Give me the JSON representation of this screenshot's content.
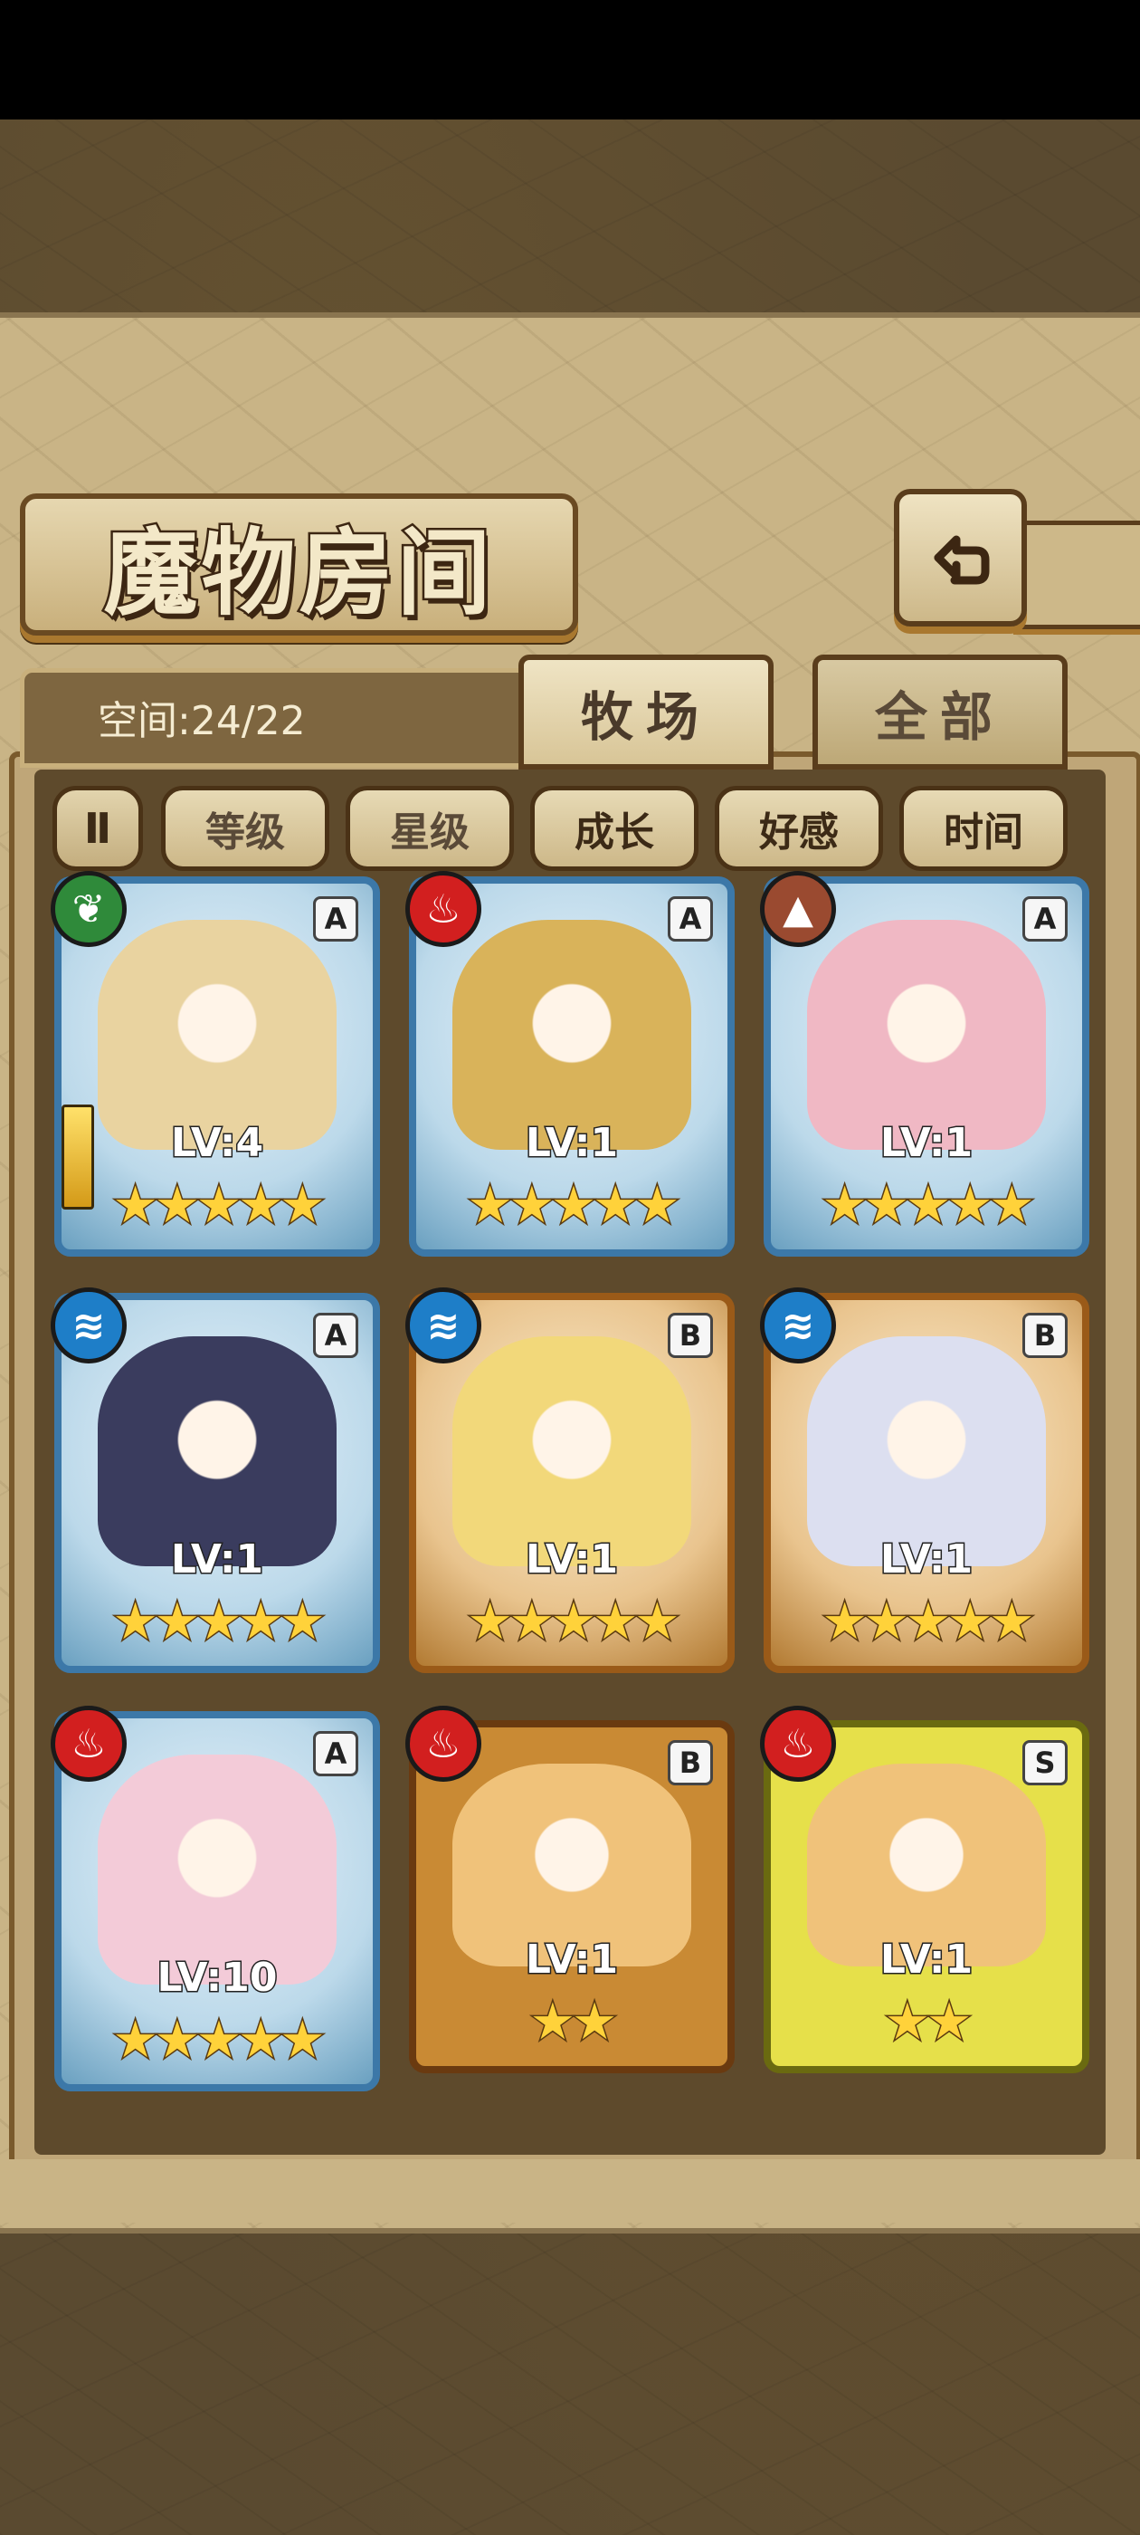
{
  "header": {
    "title": "魔物房间"
  },
  "capacity": {
    "label": "空间:24/22"
  },
  "tabs": [
    {
      "label": "牧场",
      "active": true
    },
    {
      "label": "全部",
      "active": false
    }
  ],
  "sort": {
    "toggle_icon": "filter-toggle-icon",
    "buttons": [
      "等级",
      "星级",
      "成长",
      "好感",
      "时间"
    ]
  },
  "monsters": [
    {
      "element": "leaf-icon",
      "rank": "A",
      "level": "LV:4",
      "stars": 5,
      "frame": "blue"
    },
    {
      "element": "fire-icon",
      "rank": "A",
      "level": "LV:1",
      "stars": 5,
      "frame": "blue"
    },
    {
      "element": "earth-icon",
      "rank": "A",
      "level": "LV:1",
      "stars": 5,
      "frame": "blue"
    },
    {
      "element": "water-icon",
      "rank": "A",
      "level": "LV:1",
      "stars": 5,
      "frame": "blue"
    },
    {
      "element": "water-icon",
      "rank": "B",
      "level": "LV:1",
      "stars": 5,
      "frame": "gold"
    },
    {
      "element": "water-icon",
      "rank": "B",
      "level": "LV:1",
      "stars": 5,
      "frame": "gold"
    },
    {
      "element": "fire-icon",
      "rank": "A",
      "level": "LV:10",
      "stars": 5,
      "frame": "blue"
    },
    {
      "element": "fire-icon",
      "rank": "B",
      "level": "LV:1",
      "stars": 2,
      "frame": "slime-b"
    },
    {
      "element": "fire-icon",
      "rank": "S",
      "level": "LV:1",
      "stars": 2,
      "frame": "slime-s"
    }
  ],
  "star_glyph": "★",
  "colors": {
    "panel": "#c9b486",
    "frame_blue": "#3c78a8",
    "frame_gold": "#9a5a18",
    "star": "#ffd23a"
  }
}
